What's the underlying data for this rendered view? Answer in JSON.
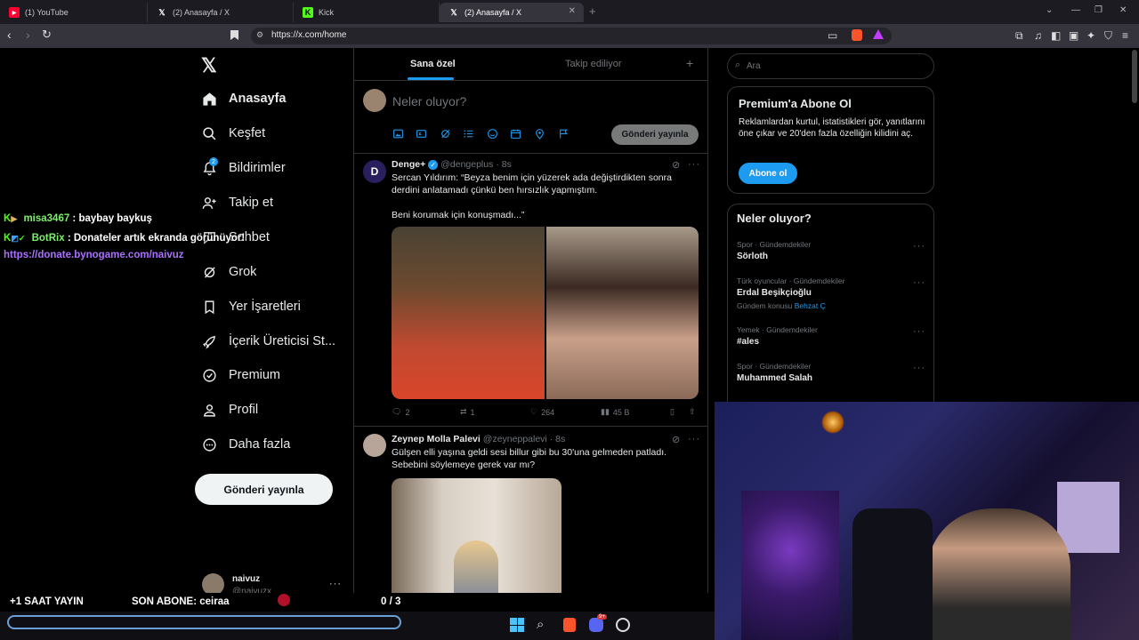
{
  "browser": {
    "tabs": [
      {
        "title": "(1) YouTube",
        "icon": "youtube-icon",
        "active": false
      },
      {
        "title": "(2) Anasayfa / X",
        "icon": "x-logo-icon",
        "active": false
      },
      {
        "title": "Kick",
        "icon": "kick-icon",
        "active": false
      },
      {
        "title": "(2) Anasayfa / X",
        "icon": "x-logo-icon",
        "active": true
      }
    ],
    "url": "https://x.com/home"
  },
  "sidebar": {
    "items": [
      {
        "label": "Anasayfa",
        "icon": "home-icon",
        "active": true
      },
      {
        "label": "Keşfet",
        "icon": "search-icon"
      },
      {
        "label": "Bildirimler",
        "icon": "bell-icon",
        "badge": "2"
      },
      {
        "label": "Takip et",
        "icon": "follow-icon"
      },
      {
        "label": "Sohbet",
        "icon": "chat-icon"
      },
      {
        "label": "Grok",
        "icon": "grok-icon"
      },
      {
        "label": "Yer İşaretleri",
        "icon": "bookmark-icon"
      },
      {
        "label": "İçerik Üreticisi St...",
        "icon": "rocket-icon"
      },
      {
        "label": "Premium",
        "icon": "premium-icon"
      },
      {
        "label": "Profil",
        "icon": "person-icon"
      },
      {
        "label": "Daha fazla",
        "icon": "more-circle-icon"
      }
    ],
    "post_button": "Gönderi yayınla",
    "account": {
      "name": "naivuz",
      "handle": "@naivuzx"
    }
  },
  "feed": {
    "tabs": [
      "Sana özel",
      "Takip ediliyor"
    ],
    "composer_placeholder": "Neler oluyor?",
    "composer_button": "Gönderi yayınla",
    "tweets": [
      {
        "name": "Denge+",
        "handle": "@dengeplus",
        "time": "· 8s",
        "verified": true,
        "text": "Sercan Yıldırım: “Beyza benim için yüzerek ada değiştirdikten sonra derdini anlatamadı çünkü ben hırsızlık yapmıştım.\n\nBeni korumak için konuşmadı...”",
        "stats": {
          "replies": "2",
          "reposts": "1",
          "likes": "264",
          "views": "45 B"
        }
      },
      {
        "name": "Zeynep Molla Palevi",
        "handle": "@zeyneppalevi",
        "time": "· 8s",
        "verified": false,
        "text": "Gülşen elli yaşına geldi sesi billur gibi bu 30'una gelmeden patladı. Sebebini söylemeye gerek var mı?"
      }
    ]
  },
  "right": {
    "search_placeholder": "Ara",
    "premium": {
      "title": "Premium'a Abone Ol",
      "text": "Reklamlardan kurtul, istatistikleri gör, yanıtlarını öne çıkar ve 20'den fazla özelliğin kilidini aç.",
      "button": "Abone ol"
    },
    "trends_title": "Neler oluyor?",
    "trends": [
      {
        "category": "Spor · Gündemdekiler",
        "name": "Sörloth"
      },
      {
        "category": "Türk oyuncular · Gündemdekiler",
        "name": "Erdal Beşikçioğlu",
        "sub_prefix": "Gündem konusu",
        "sub_link": "Behzat Ç"
      },
      {
        "category": "Yemek · Gündemdekiler",
        "name": "#ales"
      },
      {
        "category": "Spor · Gündemdekiler",
        "name": "Muhammed Salah"
      }
    ]
  },
  "stream_overlay": {
    "chat": [
      {
        "user": "misa3467",
        "message": " : baybay baykuş",
        "user_color": "#7cf068"
      },
      {
        "user": "BotRix",
        "message": " : Donateler artık ekranda görünüyor!",
        "user_color": "#7cf068"
      }
    ],
    "link": "https://donate.bynogame.com/naivuz",
    "bottom": {
      "left": "+1 SAAT YAYIN",
      "sub_label": "SON ABONE: ceiraa",
      "counter": "0 / 3"
    }
  },
  "taskbar": {
    "notification_badge": "9+"
  },
  "colors": {
    "accent": "#1d9bf0",
    "kick_green": "#53fc18",
    "link_purple": "#a970ff"
  }
}
